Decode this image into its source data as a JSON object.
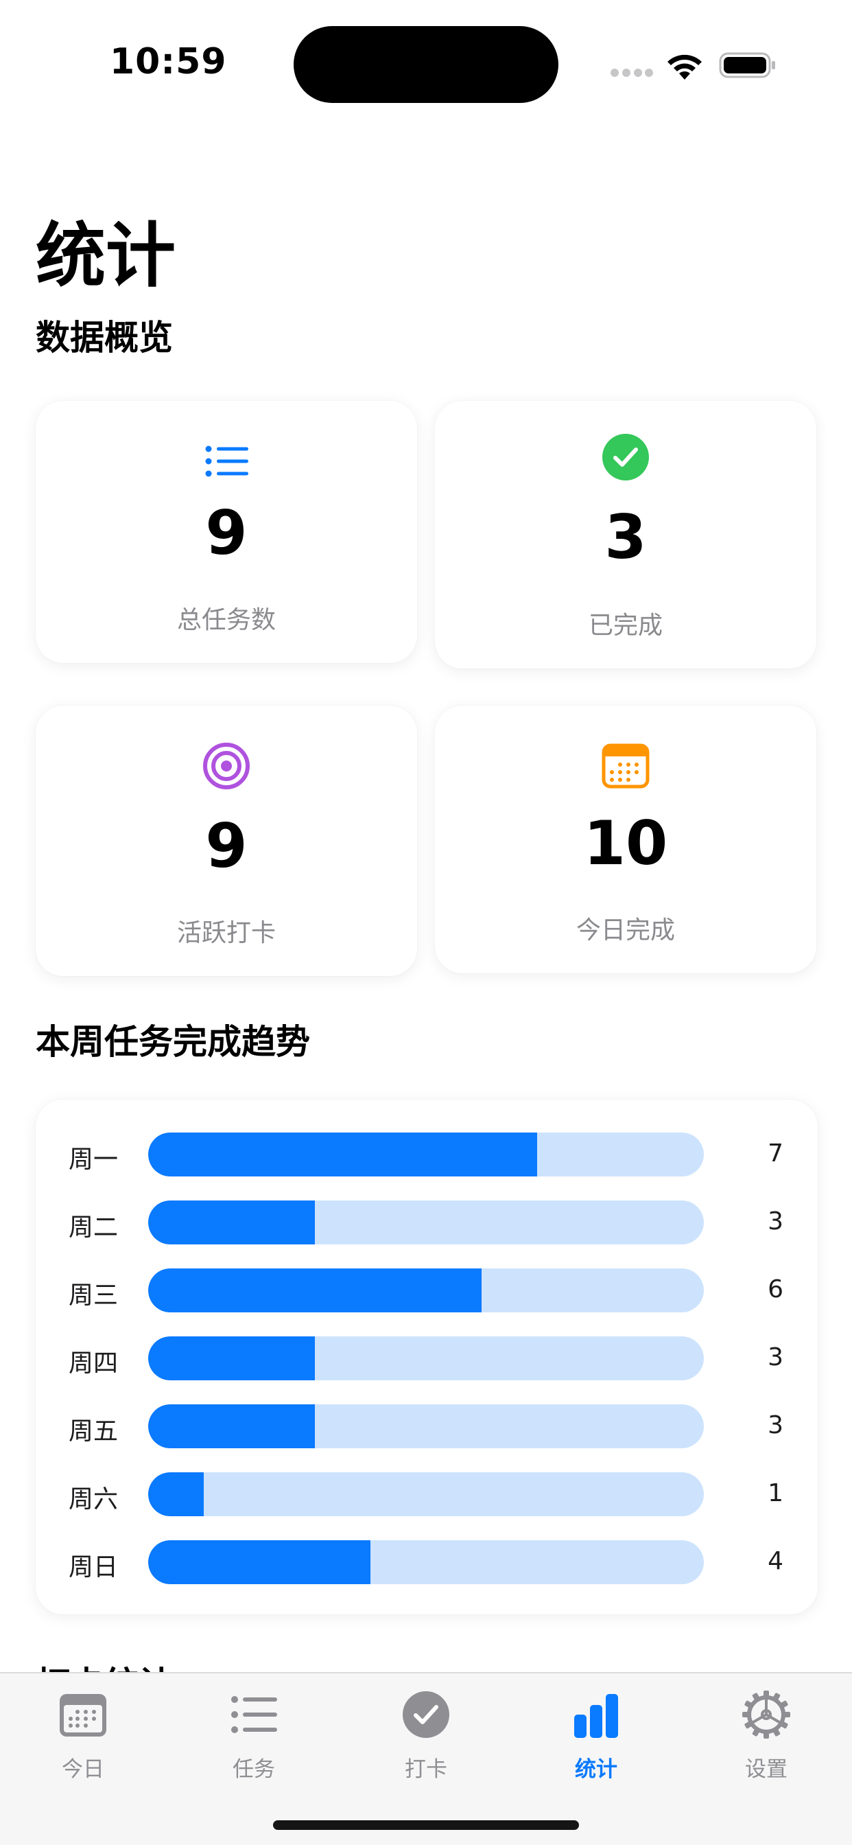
{
  "status_bar": {
    "time": "10:59"
  },
  "header": {
    "title": "统计",
    "overview_title": "数据概览"
  },
  "stats": [
    {
      "value": "9",
      "label": "总任务数",
      "icon": "list-icon",
      "color": "#0a7aff"
    },
    {
      "value": "3",
      "label": "已完成",
      "icon": "checkmark-circle-icon",
      "color": "#34c759"
    },
    {
      "value": "9",
      "label": "活跃打卡",
      "icon": "target-icon",
      "color": "#af52de"
    },
    {
      "value": "10",
      "label": "今日完成",
      "icon": "calendar-icon",
      "color": "#ff9500"
    }
  ],
  "trend_title": "本周任务完成趋势",
  "chart_data": {
    "type": "bar",
    "orientation": "horizontal",
    "categories": [
      "周一",
      "周二",
      "周三",
      "周四",
      "周五",
      "周六",
      "周日"
    ],
    "values": [
      7,
      3,
      6,
      3,
      3,
      1,
      4
    ],
    "xlim": [
      0,
      10
    ],
    "colors": {
      "fill": "#0a7aff",
      "track": "#cde3fd"
    }
  },
  "next_section_title": "打卡统计",
  "tab_bar": {
    "items": [
      {
        "label": "今日",
        "icon": "calendar-icon",
        "active": false
      },
      {
        "label": "任务",
        "icon": "list-icon",
        "active": false
      },
      {
        "label": "打卡",
        "icon": "checkmark-circle-icon",
        "active": false
      },
      {
        "label": "统计",
        "icon": "chart-bar-icon",
        "active": true
      },
      {
        "label": "设置",
        "icon": "gear-icon",
        "active": false
      }
    ],
    "active_color": "#0a7aff",
    "inactive_color": "#8e8e93"
  }
}
